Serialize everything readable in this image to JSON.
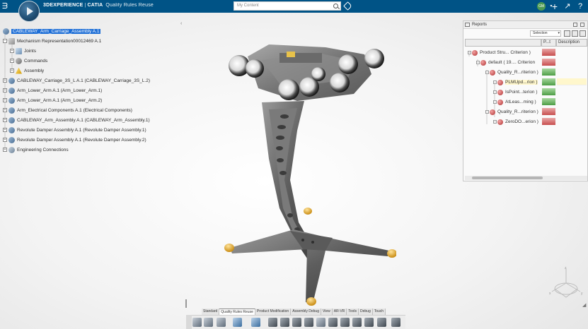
{
  "topbar": {
    "brand_bold": "3DEXPERIENCE",
    "brand_sep": "|",
    "brand_product": "CATIA",
    "app_name": "Quality Rules Reuse",
    "search_placeholder": "My Content",
    "avatar_initials": "GM"
  },
  "tree": {
    "items": [
      {
        "label": "CABLEWAY_Arm_Carriage_Assembly A.1",
        "selected": true
      },
      {
        "label": "Mechanism Representation00012469 A.1"
      },
      {
        "label": "Joints"
      },
      {
        "label": "Commands"
      },
      {
        "label": "Assembly"
      },
      {
        "label": "CABLEWAY_Carriage_3S_L A.1 (CABLEWAY_Carriage_3S_L.2)"
      },
      {
        "label": "Arm_Lower_Arm A.1 (Arm_Lower_Arm.1)"
      },
      {
        "label": "Arm_Lower_Arm A.1 (Arm_Lower_Arm.2)"
      },
      {
        "label": "Arm_Electrical Components A.1 (Electrical Components)"
      },
      {
        "label": "CABLEWAY_Arm_Assembly A.1 (CABLEWAY_Arm_Assembly.1)"
      },
      {
        "label": "Revolute Damper Assembly A.1 (Revolute Damper Assembly.1)"
      },
      {
        "label": "Revolute Damper Assembly A.1 (Revolute Damper Assembly.2)"
      },
      {
        "label": "Engineering Connections"
      }
    ]
  },
  "reports": {
    "title": "Reports",
    "filter": "Selection",
    "columns": [
      "",
      "P...t",
      "Description"
    ],
    "rows": [
      {
        "label": "Product Stru... Criterion )",
        "status": "red"
      },
      {
        "label": "default ( 19.... Criterion",
        "status": "red"
      },
      {
        "label": "Quality_R...riterion )",
        "status": "green"
      },
      {
        "label": "PLMUpd...rion )",
        "status": "green",
        "highlight": true
      },
      {
        "label": "IsPoint...terion )",
        "status": "green"
      },
      {
        "label": "AtLeas...ming )",
        "status": "green"
      },
      {
        "label": "Quality_R...riterion )",
        "status": "red"
      },
      {
        "label": "ZeroDO...erion )",
        "status": "red"
      }
    ]
  },
  "toolbar": {
    "tabs": [
      "Standard",
      "Quality Rules Reuse",
      "Product Modification",
      "Assembly Debug",
      "View",
      "AR-VR",
      "Tools",
      "Debug",
      "Touch"
    ],
    "active_tab": "Quality Rules Reuse"
  },
  "colors": {
    "topbar": "#005386",
    "selection": "#1f6fd6",
    "status_red": "#c74d4d",
    "status_green": "#4d9e45"
  }
}
